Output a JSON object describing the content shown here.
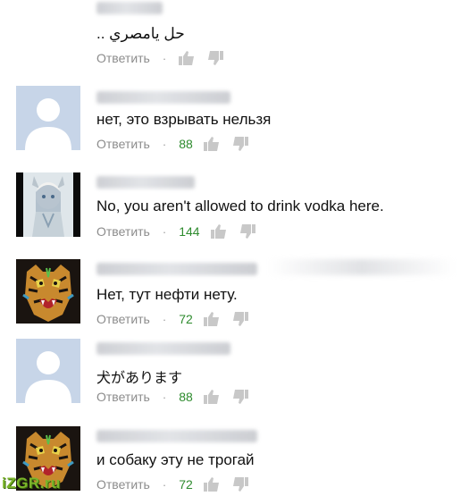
{
  "comments": [
    {
      "text": "حل يامصري ..",
      "reply_label": "Ответить",
      "likes": ""
    },
    {
      "text": "нет, это взрывать нельзя",
      "reply_label": "Ответить",
      "likes": "88"
    },
    {
      "text": "No, you aren't allowed to drink vodka here.",
      "reply_label": "Ответить",
      "likes": "144"
    },
    {
      "text": "Нет, тут нефти нету.",
      "reply_label": "Ответить",
      "likes": "72"
    },
    {
      "text": "犬があります",
      "reply_label": "Ответить",
      "likes": "88"
    },
    {
      "text": "и собаку эту не трогай",
      "reply_label": "Ответить",
      "likes": "72"
    }
  ],
  "watermark": "iZGR.ru",
  "colors": {
    "reply": "#8c8c8c",
    "likes": "#2e8b2e",
    "watermark": "#7bb52a"
  },
  "icons": {
    "like": "thumbs-up-icon",
    "dislike": "thumbs-down-icon",
    "avatar_default": "default-user-icon"
  }
}
